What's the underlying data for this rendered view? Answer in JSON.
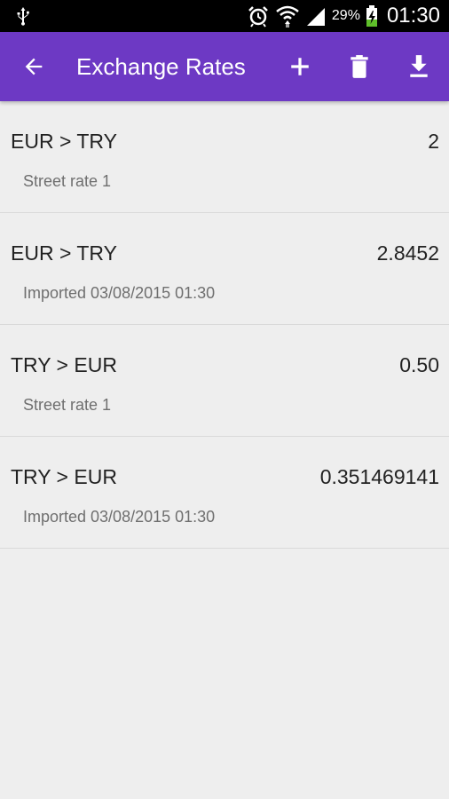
{
  "status_bar": {
    "battery_percent": "29%",
    "time": "01:30",
    "icons": [
      "usb-icon",
      "alarm-icon",
      "wifi-icon",
      "signal-icon",
      "battery-charging-icon"
    ]
  },
  "app_bar": {
    "title": "Exchange Rates",
    "background": "#6d39c4",
    "icons": [
      "back-arrow-icon",
      "add-icon",
      "trash-icon",
      "download-icon"
    ]
  },
  "rates": [
    {
      "pair": "EUR > TRY",
      "rate": "2",
      "sub": "Street rate 1"
    },
    {
      "pair": "EUR > TRY",
      "rate": "2.8452",
      "sub": "Imported 03/08/2015 01:30"
    },
    {
      "pair": "TRY > EUR",
      "rate": "0.50",
      "sub": "Street rate 1"
    },
    {
      "pair": "TRY > EUR",
      "rate": "0.351469141",
      "sub": "Imported 03/08/2015 01:30"
    }
  ]
}
